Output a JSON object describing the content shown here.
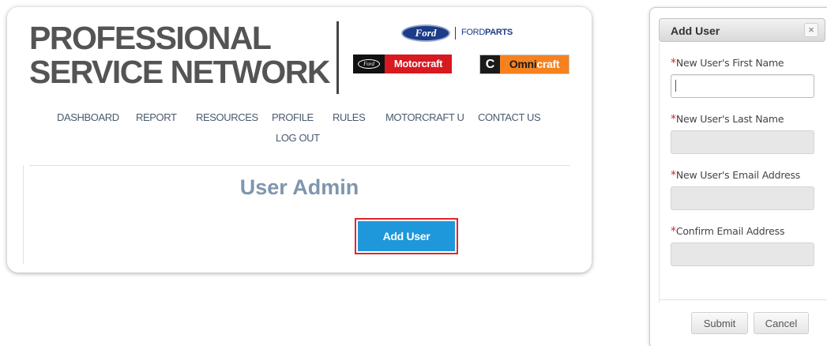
{
  "brand": {
    "title_line1": "PROFESSIONAL",
    "title_line2": "SERVICE NETWORK",
    "ford_logo_text": "Ford",
    "ford_parts_prefix": "FORD",
    "ford_parts_suffix": "PARTS",
    "motorcraft_badge_text": "Ford",
    "motorcraft_label": "Motorcraft",
    "omnicraft_icon": "C",
    "omnicraft_prefix": "Omni",
    "omnicraft_suffix": "craft"
  },
  "nav": {
    "items": [
      {
        "label": "DASHBOARD"
      },
      {
        "label": "REPORT"
      },
      {
        "label": "RESOURCES"
      },
      {
        "label": "PROFILE"
      },
      {
        "label": "RULES"
      },
      {
        "label": "MOTORCRAFT U"
      },
      {
        "label": "CONTACT US"
      },
      {
        "label": "LOG OUT"
      }
    ]
  },
  "page": {
    "title": "User Admin",
    "add_user_label": "Add User"
  },
  "dialog": {
    "title": "Add User",
    "close_label": "×",
    "required_marker": "*",
    "fields": [
      {
        "label": "New User's First Name",
        "value": ""
      },
      {
        "label": "New User's Last Name",
        "value": ""
      },
      {
        "label": "New User's Email Address",
        "value": ""
      },
      {
        "label": "Confirm Email Address",
        "value": ""
      }
    ],
    "submit_label": "Submit",
    "cancel_label": "Cancel"
  },
  "colors": {
    "ford_blue": "#1b3c88",
    "motorcraft_red": "#d71920",
    "omnicraft_orange": "#f5821f",
    "button_blue": "#1f97db",
    "focus_red": "#e0262b",
    "heading_blue_gray": "#7e96ae",
    "required_red": "#d9262b"
  }
}
